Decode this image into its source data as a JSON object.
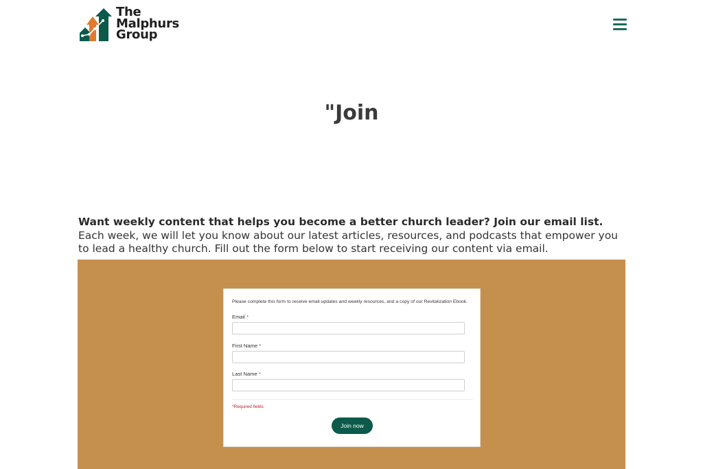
{
  "brand": {
    "logo_lines": [
      "The",
      "Malphurs",
      "Group"
    ],
    "colors": {
      "green": "#0d5a4a",
      "orange": "#e07a2e",
      "band": "#c5904d",
      "hamburger": "#1d6b5b"
    }
  },
  "nav": {
    "menu_icon": "hamburger-menu-icon"
  },
  "page": {
    "title": "\"Join"
  },
  "intro": {
    "headline": "Want weekly content that helps you become a better church leader? Join our email list.",
    "body": "Each week, we will let you know about our latest articles, resources, and podcasts that empower you to lead a healthy church. Fill out the form below to start receiving our content via email."
  },
  "form": {
    "note": "Please complete this form to receive email updates and weekly resources, and a copy of our Revitalization Ebook.",
    "fields": [
      {
        "label": "Email",
        "required_mark": "*",
        "value": ""
      },
      {
        "label": "First Name",
        "required_mark": "*",
        "value": ""
      },
      {
        "label": "Last Name",
        "required_mark": "*",
        "value": ""
      }
    ],
    "required_note": "*Required fields",
    "submit_label": "Join now"
  }
}
